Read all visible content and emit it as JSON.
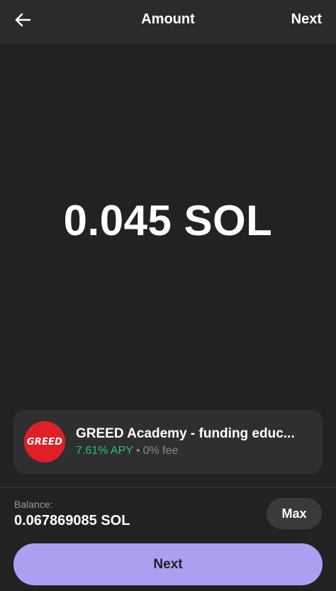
{
  "header": {
    "back_icon": "arrow-left-icon",
    "title": "Amount",
    "next_label": "Next"
  },
  "amount": {
    "display": "0.045 SOL"
  },
  "validator": {
    "logo_text": "GREED",
    "name": "GREED Academy - funding educ...",
    "apy": "7.61% APY",
    "separator": "•",
    "fee": "0% fee",
    "logo_color": "#e01f26"
  },
  "balance": {
    "label": "Balance:",
    "value": "0.067869085 SOL"
  },
  "max_label": "Max",
  "next_button_label": "Next",
  "colors": {
    "background": "#222222",
    "accent": "#ab9ff2",
    "apy_green": "#21c55d"
  }
}
